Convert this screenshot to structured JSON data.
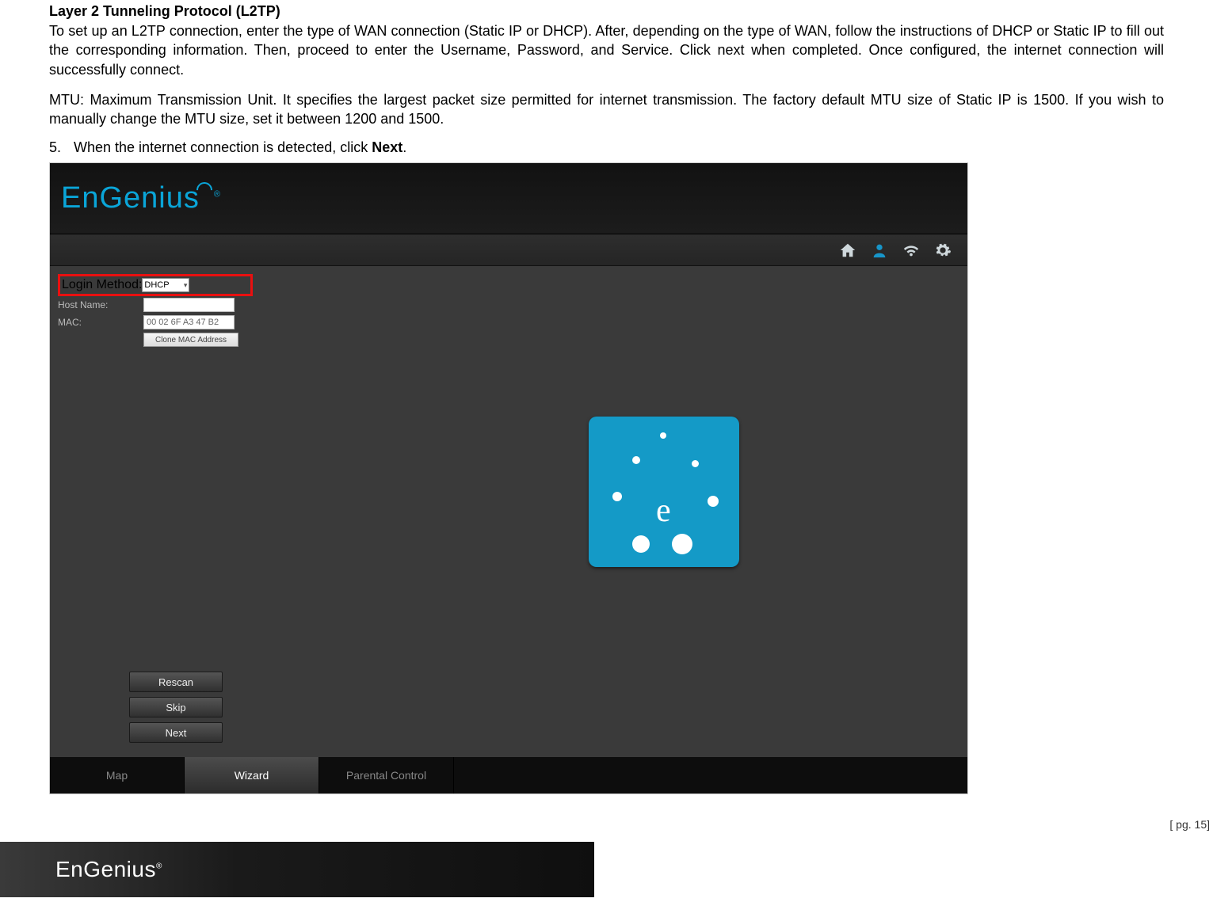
{
  "doc": {
    "heading": "Layer 2 Tunneling Protocol (L2TP)",
    "para1": " To set up an L2TP connection, enter the type of WAN connection (Static IP or DHCP). After, depending on the type of WAN, follow the instructions of DHCP or Static IP to fill out the corresponding information. Then, proceed to enter the Username, Password, and Service. Click next when completed. Once configured, the internet connection will successfully connect.",
    "para2": "MTU: Maximum Transmission Unit. It specifies the largest packet size permitted for internet transmission. The factory default MTU size of Static IP is 1500. If you wish to manually change the MTU size, set it between 1200 and 1500.",
    "step_num": "5.",
    "step_text_a": "When the internet connection is detected, click ",
    "step_text_b": "Next",
    "step_text_c": ".",
    "page_number": "[ pg. 15]"
  },
  "ui": {
    "brand": "EnGenius",
    "brand_reg": "®",
    "form": {
      "login_method_label": "Login Method:",
      "login_method_value": "DHCP",
      "host_name_label": "Host Name:",
      "mac_label": "MAC:",
      "mac_value": "00 02 6F A3 47 B2",
      "clone_btn": "Clone MAC Address"
    },
    "buttons": {
      "rescan": "Rescan",
      "skip": "Skip",
      "next": "Next"
    },
    "tabs": {
      "map": "Map",
      "wizard": "Wizard",
      "parental": "Parental Control"
    },
    "tile_letter": "e"
  },
  "footer": {
    "brand": "EnGenius",
    "reg": "®"
  }
}
